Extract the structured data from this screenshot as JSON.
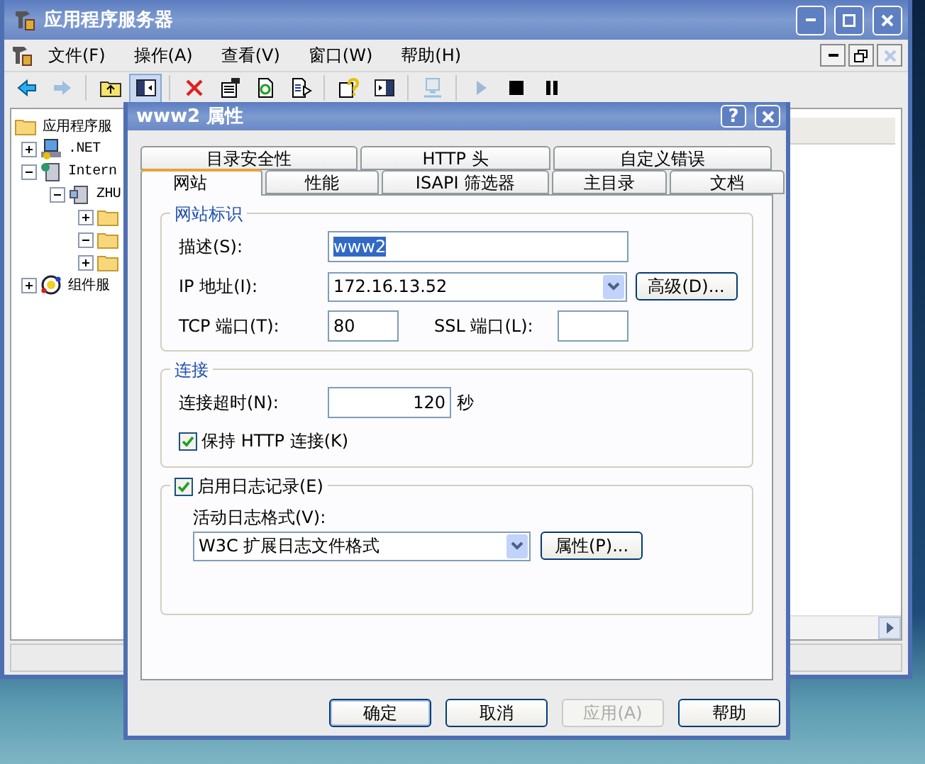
{
  "main_window": {
    "title": "应用程序服务器",
    "menu": [
      "文件(F)",
      "操作(A)",
      "查看(V)",
      "窗口(W)",
      "帮助(H)"
    ],
    "toolbar": [
      {
        "kind": "back",
        "disabled": false,
        "pressed": false
      },
      {
        "kind": "forward",
        "disabled": true,
        "pressed": false
      },
      {
        "kind": "sep"
      },
      {
        "kind": "up",
        "disabled": false,
        "pressed": false
      },
      {
        "kind": "tree",
        "disabled": false,
        "pressed": true
      },
      {
        "kind": "sep"
      },
      {
        "kind": "delete",
        "disabled": false,
        "pressed": false
      },
      {
        "kind": "properties",
        "disabled": false,
        "pressed": false
      },
      {
        "kind": "refresh",
        "disabled": false,
        "pressed": false
      },
      {
        "kind": "export",
        "disabled": false,
        "pressed": false
      },
      {
        "kind": "sep"
      },
      {
        "kind": "help",
        "disabled": false,
        "pressed": false
      },
      {
        "kind": "panel",
        "disabled": false,
        "pressed": false
      },
      {
        "kind": "sep"
      },
      {
        "kind": "computer",
        "disabled": true,
        "pressed": false
      },
      {
        "kind": "sep"
      },
      {
        "kind": "play",
        "disabled": true,
        "pressed": false
      },
      {
        "kind": "stop",
        "disabled": false,
        "pressed": false
      },
      {
        "kind": "pause",
        "disabled": false,
        "pressed": false
      }
    ],
    "tree": [
      {
        "label": "应用程序服",
        "kind": "folder",
        "children": [
          {
            "label": ".NET",
            "kind": "net",
            "expanded": false
          },
          {
            "label": "Intern",
            "kind": "iis",
            "expanded": true,
            "children": [
              {
                "label": "ZHU",
                "kind": "server",
                "expanded": true,
                "children": [
                  {
                    "kind": "folder",
                    "expanded": false
                  },
                  {
                    "kind": "folder",
                    "expanded": true
                  },
                  {
                    "kind": "folder",
                    "expanded": false
                  }
                ]
              }
            ]
          },
          {
            "label": "组件服",
            "kind": "component",
            "expanded": false
          }
        ]
      }
    ]
  },
  "dialog": {
    "title": "www2 属性",
    "help_button": "?",
    "tabs_back": [
      {
        "label": "目录安全性",
        "selected": false
      },
      {
        "label": "HTTP 头",
        "selected": false
      },
      {
        "label": "自定义错误",
        "selected": false
      }
    ],
    "tabs_front": [
      {
        "label": "网站",
        "selected": true
      },
      {
        "label": "性能",
        "selected": false
      },
      {
        "label": "ISAPI 筛选器",
        "selected": false
      },
      {
        "label": "主目录",
        "selected": false
      },
      {
        "label": "文档",
        "selected": false
      }
    ],
    "identity": {
      "legend": "网站标识",
      "description_label": "描述(S):",
      "description_value": "www2",
      "ip_label": "IP 地址(I):",
      "ip_value": "172.16.13.52",
      "advanced_button": "高级(D)...",
      "tcp_label": "TCP 端口(T):",
      "tcp_value": "80",
      "ssl_label": "SSL 端口(L):"
    },
    "connection": {
      "legend": "连接",
      "timeout_label": "连接超时(N):",
      "timeout_value": "120",
      "timeout_unit": "秒",
      "keepalive": {
        "label": "保持 HTTP 连接(K)",
        "checked": true
      }
    },
    "logging": {
      "enable": {
        "label": "启用日志记录(E)",
        "checked": true
      },
      "format_label": "活动日志格式(V):",
      "format_value": "W3C 扩展日志文件格式",
      "properties_button": "属性(P)..."
    },
    "buttons": [
      {
        "label": "确定",
        "default": true,
        "disabled": false
      },
      {
        "label": "取消",
        "default": false,
        "disabled": false
      },
      {
        "label": "应用(A)",
        "default": false,
        "disabled": true
      },
      {
        "label": "帮助",
        "default": false,
        "disabled": false
      }
    ]
  }
}
